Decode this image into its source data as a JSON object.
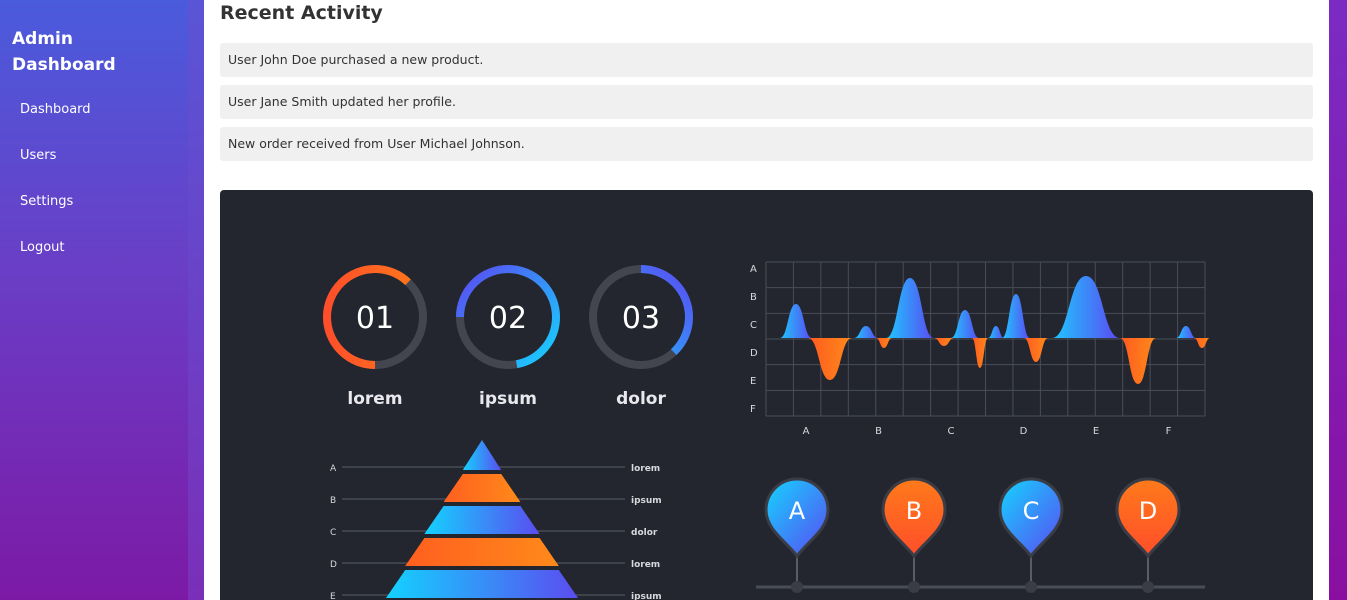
{
  "sidebar": {
    "brand": "Admin Dashboard",
    "items": [
      {
        "label": "Dashboard"
      },
      {
        "label": "Users"
      },
      {
        "label": "Settings"
      },
      {
        "label": "Logout"
      }
    ]
  },
  "main": {
    "section_title": "Recent Activity",
    "activities": [
      {
        "text": "User John Doe purchased a new product."
      },
      {
        "text": "User Jane Smith updated her profile."
      },
      {
        "text": "New order received from User Michael Johnson."
      }
    ]
  },
  "infographic": {
    "rings": [
      {
        "number": "01",
        "label": "lorem",
        "progress": 0.62
      },
      {
        "number": "02",
        "label": "ipsum",
        "progress": 0.72
      },
      {
        "number": "03",
        "label": "dolor",
        "progress": 0.38
      }
    ],
    "wave_rows": [
      "A",
      "B",
      "C",
      "D",
      "E",
      "F"
    ],
    "wave_cols": [
      "A",
      "B",
      "C",
      "D",
      "E",
      "F"
    ],
    "pyramid_left": [
      "A",
      "B",
      "C",
      "D",
      "E"
    ],
    "pyramid_right": [
      "lorem",
      "ipsum",
      "dolor",
      "lorem",
      "ipsum"
    ],
    "pins": [
      {
        "letter": "A"
      },
      {
        "letter": "B"
      },
      {
        "letter": "C"
      },
      {
        "letter": "D"
      }
    ],
    "colors": {
      "orange": "#ff6a1a",
      "blue": "#1ec8ff",
      "purple": "#5b49f2",
      "bg": "#23262e",
      "track": "#44464f"
    }
  }
}
